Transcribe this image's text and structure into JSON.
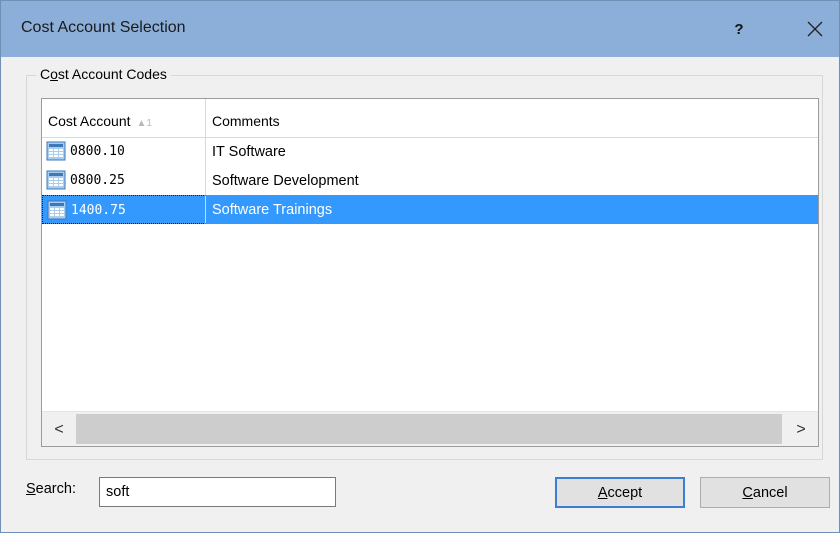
{
  "window": {
    "title": "Cost Account Selection",
    "help_label": "?",
    "close_label": "✕"
  },
  "group": {
    "label_prefix": "C",
    "label_accel": "o",
    "label_rest": "st Account Codes"
  },
  "grid": {
    "columns": [
      {
        "label": "Cost Account",
        "sort": "▲1"
      },
      {
        "label": "Comments"
      }
    ],
    "rows": [
      {
        "code": "0800.10",
        "comment": "IT Software",
        "selected": false
      },
      {
        "code": "0800.25",
        "comment": "Software Development",
        "selected": false
      },
      {
        "code": "1400.75",
        "comment": "Software Trainings",
        "selected": true
      }
    ],
    "scroll_left": "<",
    "scroll_right": ">"
  },
  "search": {
    "label_accel": "S",
    "label_rest": "earch:",
    "value": "soft"
  },
  "buttons": {
    "accept_accel": "A",
    "accept_rest": "ccept",
    "cancel_accel": "C",
    "cancel_rest": "ancel"
  },
  "colors": {
    "titlebar": "#8cafda",
    "selection": "#3399ff",
    "default_button_border": "#3c7fd1"
  },
  "icons": {
    "row_icon": "cost-account-grid-icon"
  }
}
